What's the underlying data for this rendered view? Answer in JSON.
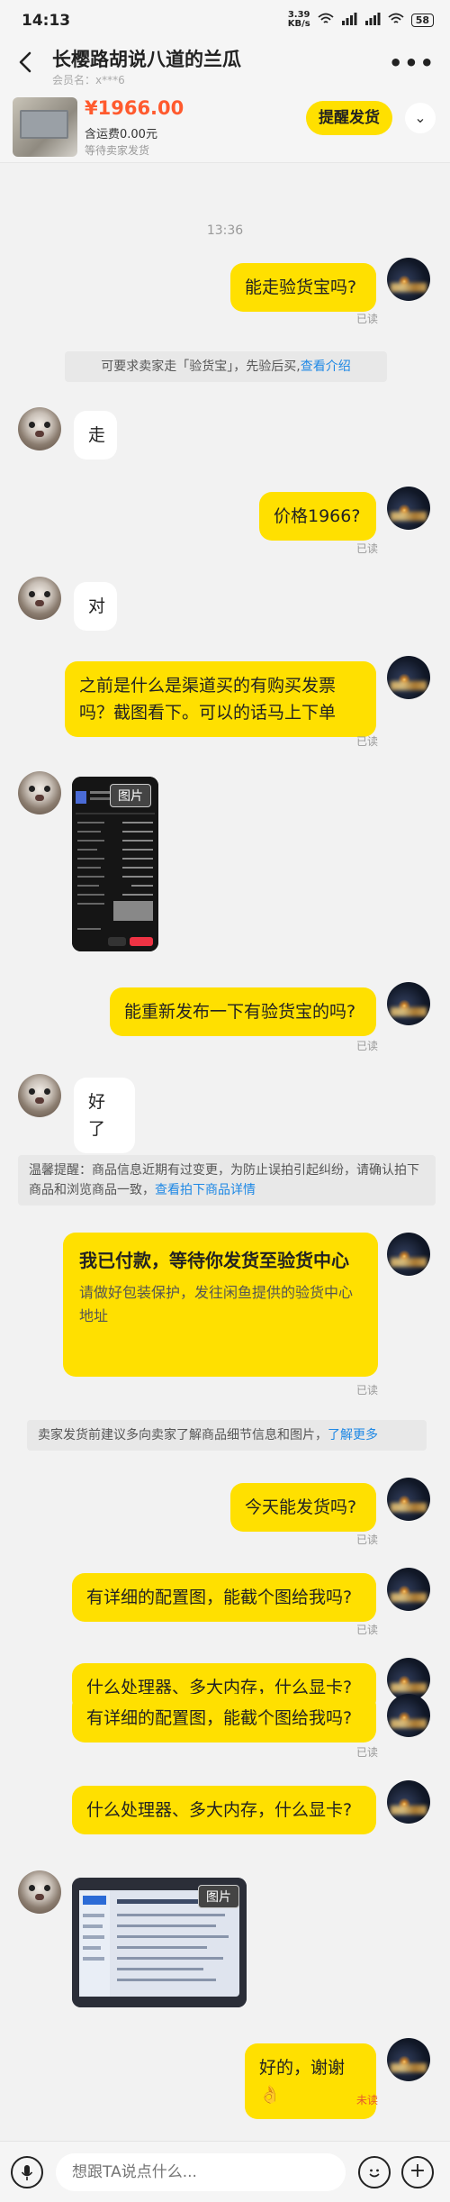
{
  "status_bar": {
    "time": "14:13",
    "net_speed_top": "3.39",
    "net_speed_unit": "KB/s",
    "battery": "58"
  },
  "header": {
    "title": "长樱路胡说八道的兰瓜",
    "subtitle": "会员名：x***6",
    "more_icon": "more-icon"
  },
  "product": {
    "price": "¥1966.00",
    "shipping": "含运费0.00元",
    "status": "等待卖家发货",
    "remind_label": "提醒发货",
    "expand_icon": "chevron-down-icon"
  },
  "chat": {
    "timestamp": "13:36",
    "read_label": "已读",
    "unread_label": "未读",
    "image_label": "图片",
    "messages": {
      "m1": "能走验货宝吗?",
      "n1_text": "可要求卖家走「验货宝」，先验后买,",
      "n1_link": "查看介绍",
      "m2": "走",
      "m3": "价格1966?",
      "m4": "对",
      "m5": "之前是什么是渠道买的有购买发票吗？截图看下。可以的话马上下单",
      "m6": "能重新发布一下有验货宝的吗?",
      "m7": "好了",
      "n2_text": "温馨提醒：商品信息近期有过变更，为防止误拍引起纠纷，请确认拍下商品和浏览商品一致，",
      "n2_link": "查看拍下商品详情",
      "card_title": "我已付款，等待你发货至验货中心",
      "card_desc": "请做好包装保护，发往闲鱼提供的验货中心地址",
      "n3_text": "卖家发货前建议多向卖家了解商品细节信息和图片，",
      "n3_link": "了解更多",
      "m8": "今天能发货吗?",
      "m9": "有详细的配置图，能截个图给我吗?",
      "m10": "什么处理器、多大内存，什么显卡?",
      "m11": "有详细的配置图，能截个图给我吗?",
      "m12": "什么处理器、多大内存，什么显卡?",
      "m13": "好的，谢谢👌"
    }
  },
  "input": {
    "placeholder": "想跟TA说点什么..."
  }
}
